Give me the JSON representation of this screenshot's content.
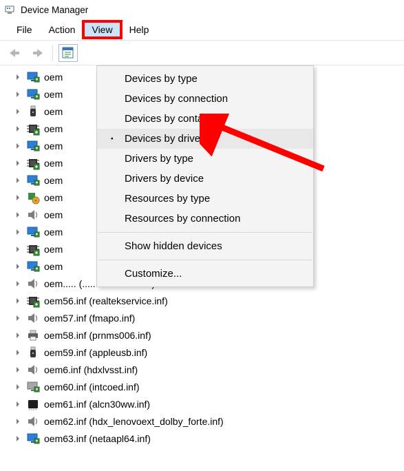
{
  "window": {
    "title": "Device Manager"
  },
  "menubar": {
    "items": [
      {
        "label": "File"
      },
      {
        "label": "Action"
      },
      {
        "label": "View"
      },
      {
        "label": "Help"
      }
    ],
    "highlighted_index": 2
  },
  "context_menu": {
    "groups": [
      [
        {
          "label": "Devices by type"
        },
        {
          "label": "Devices by connection"
        },
        {
          "label": "Devices by container"
        },
        {
          "label": "Devices by driver",
          "checked": true,
          "hovered": true
        },
        {
          "label": "Drivers by type"
        },
        {
          "label": "Drivers by device"
        },
        {
          "label": "Resources by type"
        },
        {
          "label": "Resources by connection"
        }
      ],
      [
        {
          "label": "Show hidden devices"
        }
      ],
      [
        {
          "label": "Customize..."
        }
      ]
    ]
  },
  "tree": {
    "items": [
      {
        "icon": "monitor-blue",
        "label": "oem"
      },
      {
        "icon": "monitor-blue",
        "label": "oem"
      },
      {
        "icon": "usb",
        "label": "oem"
      },
      {
        "icon": "chip-green",
        "label": "oem"
      },
      {
        "icon": "monitor-blue",
        "label": "oem"
      },
      {
        "icon": "chip-green",
        "label": "oem"
      },
      {
        "icon": "monitor-blue",
        "label": "oem"
      },
      {
        "icon": "chip-gear",
        "label": "oem"
      },
      {
        "icon": "speaker",
        "label": "oem"
      },
      {
        "icon": "monitor-blue",
        "label": "oem"
      },
      {
        "icon": "chip-green",
        "label": "oem"
      },
      {
        "icon": "monitor-blue",
        "label": "oem"
      },
      {
        "icon": "speaker",
        "label": "oem.....   (..........................)"
      },
      {
        "icon": "chip-green",
        "label": "oem56.inf (realtekservice.inf)"
      },
      {
        "icon": "speaker",
        "label": "oem57.inf (fmapo.inf)"
      },
      {
        "icon": "printer",
        "label": "oem58.inf (prnms006.inf)"
      },
      {
        "icon": "usb",
        "label": "oem59.inf (appleusb.inf)"
      },
      {
        "icon": "speaker",
        "label": "oem6.inf (hdxlvsst.inf)"
      },
      {
        "icon": "monitor-gray",
        "label": "oem60.inf (intcoed.inf)"
      },
      {
        "icon": "chip-black",
        "label": "oem61.inf (alcn30ww.inf)"
      },
      {
        "icon": "speaker",
        "label": "oem62.inf (hdx_lenovoext_dolby_forte.inf)"
      },
      {
        "icon": "monitor-blue",
        "label": "oem63.inf (netaapl64.inf)"
      }
    ]
  }
}
